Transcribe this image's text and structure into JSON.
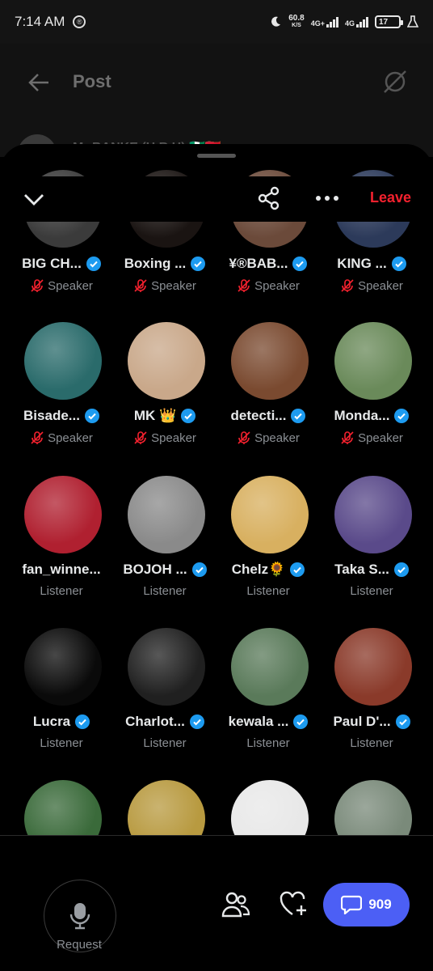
{
  "status": {
    "time": "7:14 AM",
    "speed_value": "60.8",
    "speed_unit": "K/S",
    "net1": "4G+",
    "net2": "4G",
    "battery": "17"
  },
  "post": {
    "title": "Post",
    "author": "Mr BANKE (H.R.H) 🇳🇬🇬🇭"
  },
  "space": {
    "leave_label": "Leave"
  },
  "colors": {
    "leave": "#f4212e",
    "verified": "#1d9bf0",
    "chat_button": "#4c5ff5",
    "muted_mic": "#f4212e"
  },
  "participants": [
    {
      "name": "BIG CH...",
      "role": "Speaker",
      "muted": true,
      "verified": true,
      "avatar": "#3b3b3b"
    },
    {
      "name": "Boxing ...",
      "role": "Speaker",
      "muted": true,
      "verified": true,
      "avatar": "#1a1412"
    },
    {
      "name": "¥®BAB...",
      "role": "Speaker",
      "muted": true,
      "verified": true,
      "avatar": "#6b4a3a"
    },
    {
      "name": "KING ...",
      "role": "Speaker",
      "muted": true,
      "verified": true,
      "avatar": "#2c3a5a"
    },
    {
      "name": "Bisade...",
      "role": "Speaker",
      "muted": true,
      "verified": true,
      "avatar": "#2a6b6b"
    },
    {
      "name": "MK 👑",
      "role": "Speaker",
      "muted": true,
      "verified": true,
      "avatar": "#c9a88a"
    },
    {
      "name": "detecti...",
      "role": "Speaker",
      "muted": true,
      "verified": true,
      "avatar": "#7a4a30"
    },
    {
      "name": "Monda...",
      "role": "Speaker",
      "muted": true,
      "verified": true,
      "avatar": "#6a8a5a"
    },
    {
      "name": "fan_winne...",
      "role": "Listener",
      "muted": false,
      "verified": false,
      "avatar": "#b02030"
    },
    {
      "name": "BOJOH ...",
      "role": "Listener",
      "muted": false,
      "verified": true,
      "avatar": "#8a8a8a"
    },
    {
      "name": "Chelz🌻",
      "role": "Listener",
      "muted": false,
      "verified": true,
      "avatar": "#d8b060"
    },
    {
      "name": "Taka S...",
      "role": "Listener",
      "muted": false,
      "verified": true,
      "avatar": "#5a4a8a"
    },
    {
      "name": "Lucra",
      "role": "Listener",
      "muted": false,
      "verified": true,
      "avatar": "#0a0a0a"
    },
    {
      "name": "Charlot...",
      "role": "Listener",
      "muted": false,
      "verified": true,
      "avatar": "#202020"
    },
    {
      "name": "kewala ...",
      "role": "Listener",
      "muted": false,
      "verified": true,
      "avatar": "#5a7a5a"
    },
    {
      "name": "Paul D'...",
      "role": "Listener",
      "muted": false,
      "verified": true,
      "avatar": "#8a3a2a"
    },
    {
      "name": "",
      "role": "",
      "muted": false,
      "verified": false,
      "avatar": "#3a6a3a"
    },
    {
      "name": "",
      "role": "",
      "muted": false,
      "verified": false,
      "avatar": "#b89a40"
    },
    {
      "name": "",
      "role": "",
      "muted": false,
      "verified": false,
      "avatar": "#e8e8e8"
    },
    {
      "name": "",
      "role": "",
      "muted": false,
      "verified": false,
      "avatar": "#7a8a7a"
    }
  ],
  "bottom": {
    "request_label": "Request",
    "chat_count": "909"
  },
  "icons": {
    "back": "arrow-left-icon",
    "grok": "grok-icon",
    "collapse": "chevron-down-icon",
    "share": "share-icon",
    "more": "more-horizontal-icon",
    "mic": "microphone-icon",
    "people": "people-icon",
    "heart": "heart-plus-icon",
    "chat": "chat-bubble-icon",
    "verified": "verified-badge-icon",
    "muted": "mic-off-icon"
  }
}
